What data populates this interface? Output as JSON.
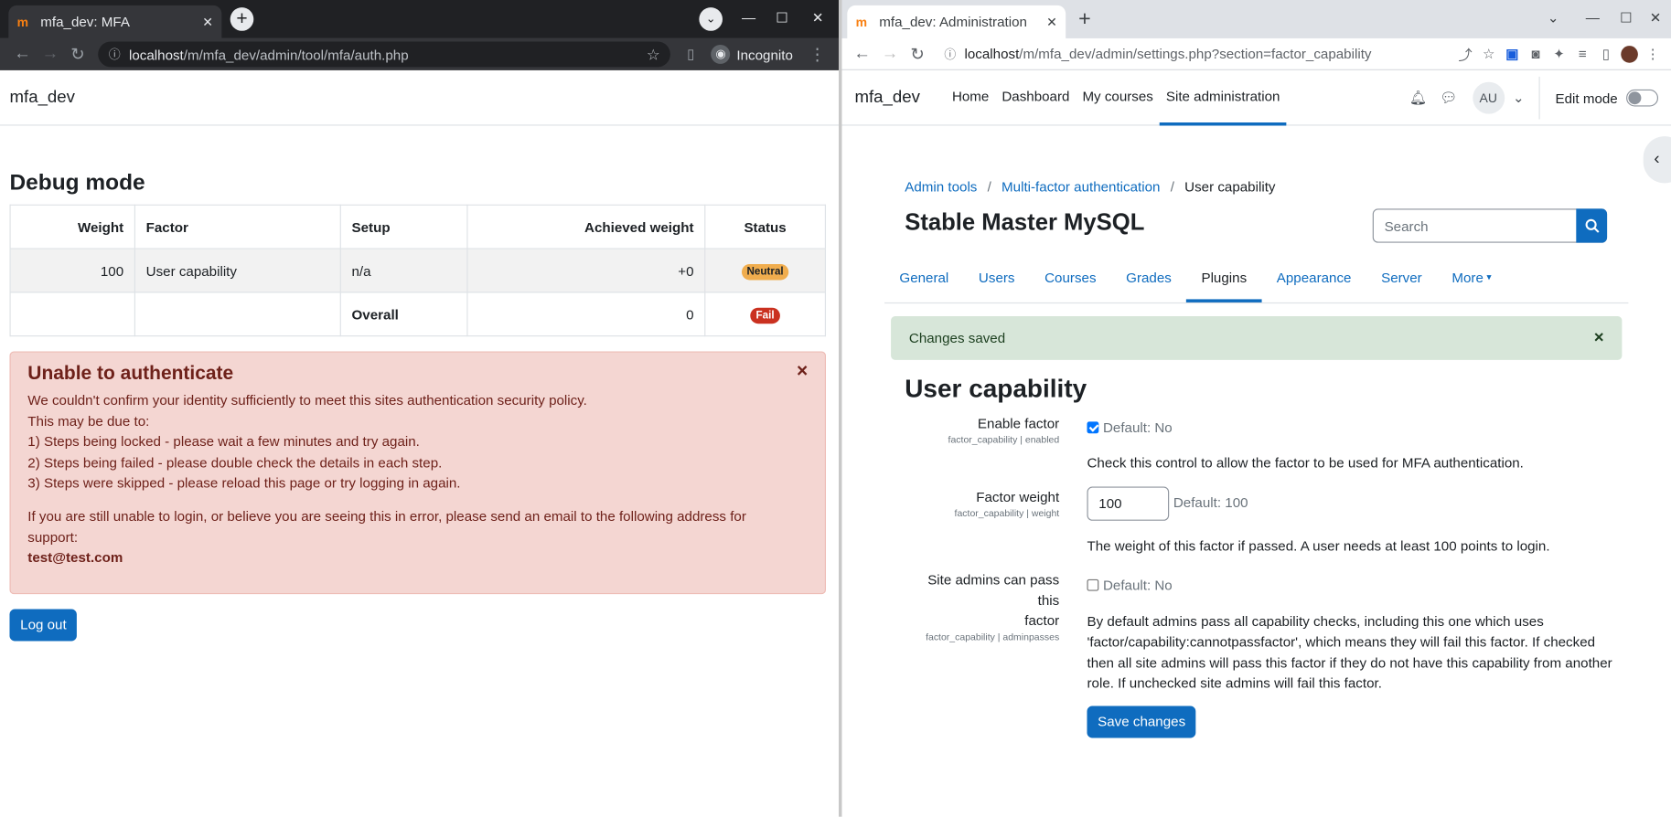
{
  "left_window": {
    "tab_title": "mfa_dev: MFA",
    "url_host": "localhost",
    "url_path": "/m/mfa_dev/admin/tool/mfa/auth.php",
    "incognito_label": "Incognito",
    "brand": "mfa_dev",
    "heading": "Debug mode",
    "table": {
      "headers": [
        "Weight",
        "Factor",
        "Setup",
        "Achieved weight",
        "Status"
      ],
      "rows": [
        {
          "weight": "100",
          "factor": "User capability",
          "setup": "n/a",
          "achieved": "+0",
          "status": "Neutral"
        },
        {
          "weight": "",
          "factor": "",
          "setup": "Overall",
          "achieved": "0",
          "status": "Fail"
        }
      ]
    },
    "alert": {
      "title": "Unable to authenticate",
      "lines": [
        "We couldn't confirm your identity sufficiently to meet this sites authentication security policy.",
        "This may be due to:",
        "1) Steps being locked - please wait a few minutes and try again.",
        "2) Steps being failed - please double check the details in each step.",
        "3) Steps were skipped - please reload this page or try logging in again."
      ],
      "support_line_1": "If you are still unable to login, or believe you are seeing this in error, please send an email to the following address for",
      "support_line_2": "support:",
      "email": "test@test.com",
      "close": "×"
    },
    "logout_label": "Log out"
  },
  "right_window": {
    "tab_title": "mfa_dev: Administration",
    "url_host": "localhost",
    "url_path": "/m/mfa_dev/admin/settings.php?section=factor_capability",
    "brand": "mfa_dev",
    "nav": [
      "Home",
      "Dashboard",
      "My courses",
      "Site administration"
    ],
    "avatar_initials": "AU",
    "edit_mode_label": "Edit mode",
    "breadcrumbs": [
      "Admin tools",
      "Multi-factor authentication",
      "User capability"
    ],
    "site_title": "Stable Master MySQL",
    "search_placeholder": "Search",
    "section_nav": [
      "General",
      "Users",
      "Courses",
      "Grades",
      "Plugins",
      "Appearance",
      "Server",
      "More"
    ],
    "success_message": "Changes saved",
    "page_heading": "User capability",
    "settings": [
      {
        "label": "Enable factor",
        "id": "factor_capability | enabled",
        "default": "Default: No",
        "checked": true,
        "description": "Check this control to allow the factor to be used for MFA authentication."
      },
      {
        "label": "Factor weight",
        "id": "factor_capability | weight",
        "value": "100",
        "default": "Default: 100",
        "description": "The weight of this factor if passed. A user needs at least 100 points to login."
      },
      {
        "label_1": "Site admins can pass this",
        "label_2": "factor",
        "id": "factor_capability | adminpasses",
        "default": "Default: No",
        "checked": false,
        "description_lines": [
          "By default admins pass all capability checks, including this one which uses",
          "'factor/capability:cannotpassfactor', which means they will fail this factor. If checked",
          "then all site admins will pass this factor if they do not have this capability from another",
          "role. If unchecked site admins will fail this factor."
        ]
      }
    ],
    "save_label": "Save changes"
  },
  "colors": {
    "primary": "#0f6cbf",
    "danger_bg": "#f4d6d2",
    "success_bg": "#d7e6d9",
    "neutral_badge": "#f0ad4e",
    "fail_badge": "#ca3120"
  }
}
